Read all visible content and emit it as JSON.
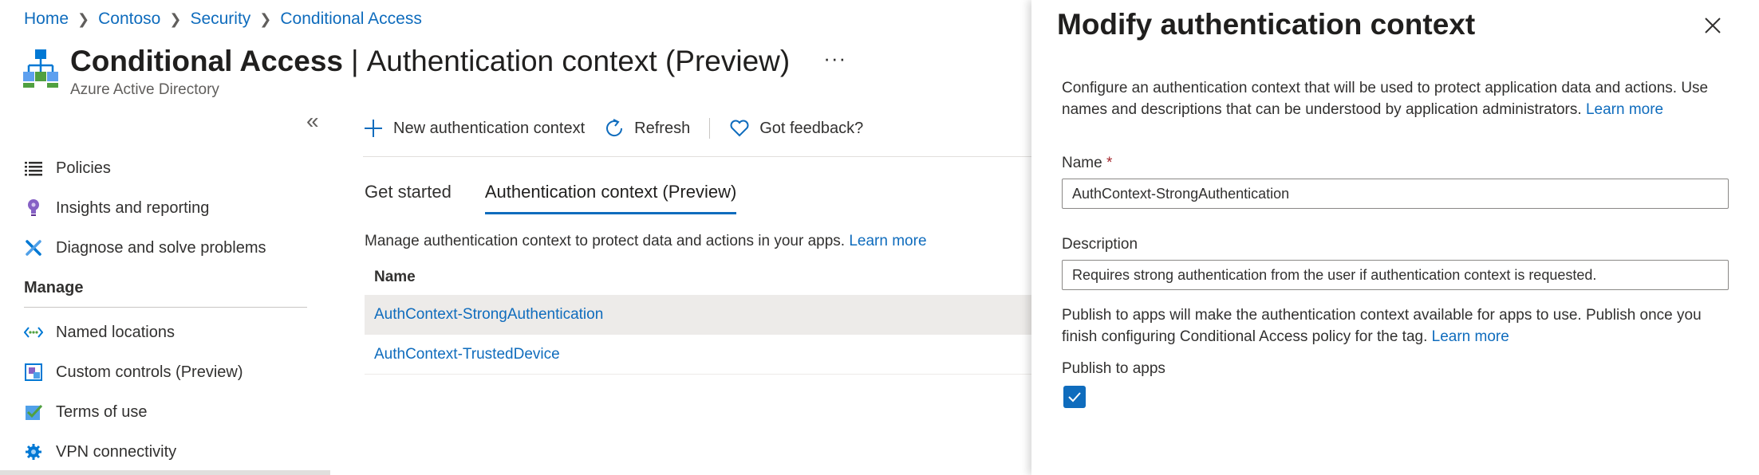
{
  "breadcrumb": [
    "Home",
    "Contoso",
    "Security",
    "Conditional Access"
  ],
  "header": {
    "title_main": "Conditional Access",
    "title_divider": "|",
    "title_sub": "Authentication context (Preview)",
    "more": "···",
    "subtitle": "Azure Active Directory",
    "icon": "conditional-access-icon"
  },
  "sidebar": {
    "collapse": "«",
    "items": [
      {
        "label": "Policies",
        "icon": "list-icon"
      },
      {
        "label": "Insights and reporting",
        "icon": "lightbulb-icon"
      },
      {
        "label": "Diagnose and solve problems",
        "icon": "wrench-icon"
      }
    ],
    "section": "Manage",
    "manage_items": [
      {
        "label": "Named locations",
        "icon": "network-icon"
      },
      {
        "label": "Custom controls (Preview)",
        "icon": "custom-controls-icon"
      },
      {
        "label": "Terms of use",
        "icon": "terms-check-icon"
      },
      {
        "label": "VPN connectivity",
        "icon": "gear-icon"
      }
    ]
  },
  "toolbar": {
    "new_label": "New authentication context",
    "refresh_label": "Refresh",
    "feedback_label": "Got feedback?"
  },
  "tabs": [
    {
      "label": "Get started",
      "active": false
    },
    {
      "label": "Authentication context (Preview)",
      "active": true
    }
  ],
  "main": {
    "description": "Manage authentication context to protect data and actions in your apps.",
    "learn_more": "Learn more",
    "table": {
      "header": "Name",
      "rows": [
        "AuthContext-StrongAuthentication",
        "AuthContext-TrustedDevice"
      ],
      "selected_index": 0
    }
  },
  "panel": {
    "title": "Modify authentication context",
    "description": "Configure an authentication context that will be used to protect application data and actions. Use names and descriptions that can be understood by application administrators.",
    "learn_more": "Learn more",
    "name_label": "Name",
    "required_mark": "*",
    "name_value": "AuthContext-StrongAuthentication",
    "description_label": "Description",
    "description_value": "Requires strong authentication from the user if authentication context is requested.",
    "publish_description": "Publish to apps will make the authentication context available for apps to use. Publish once you finish configuring Conditional Access policy for the tag.",
    "publish_learn_more": "Learn more",
    "publish_label": "Publish to apps",
    "publish_checked": true
  },
  "colors": {
    "accent": "#0f6cbd",
    "required": "#a4262c",
    "selected_row": "#edebe9"
  }
}
